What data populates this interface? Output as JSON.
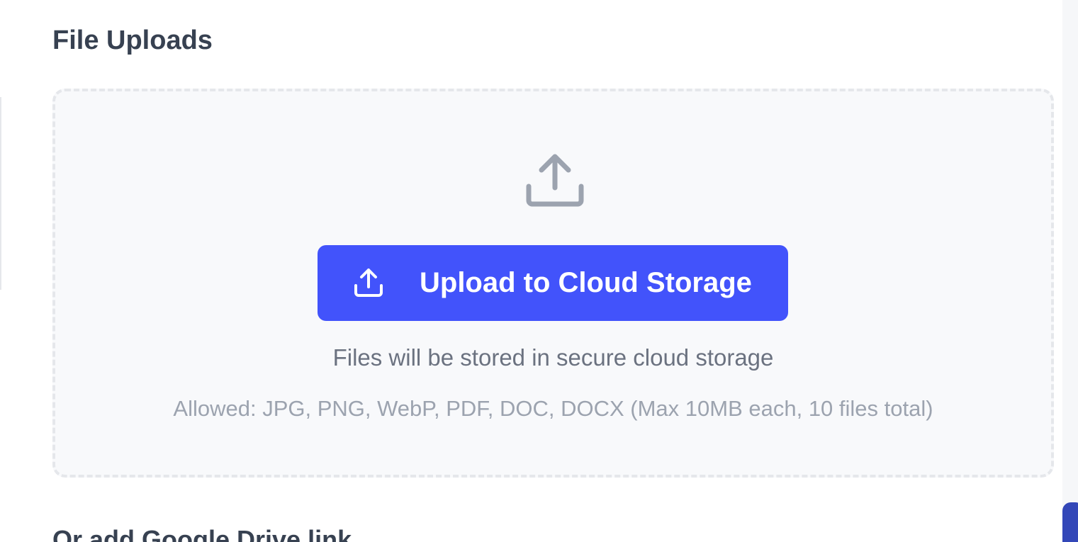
{
  "section": {
    "title": "File Uploads"
  },
  "dropzone": {
    "icon": "upload-tray-icon",
    "button_icon": "upload-icon",
    "button_label": "Upload to Cloud Storage",
    "secure_text": "Files will be stored in secure cloud storage",
    "allowed_text": "Allowed: JPG, PNG, WebP, PDF, DOC, DOCX (Max 10MB each, 10 files total)"
  },
  "drive": {
    "label": "Or add Google Drive link"
  },
  "colors": {
    "accent": "#4253fb",
    "heading": "#374151",
    "muted": "#6b7280",
    "subtle": "#9ca3af",
    "dropzone_bg": "#f8f9fb",
    "dropzone_border": "#e5e7eb",
    "scrollbar_thumb": "#3347b8"
  }
}
